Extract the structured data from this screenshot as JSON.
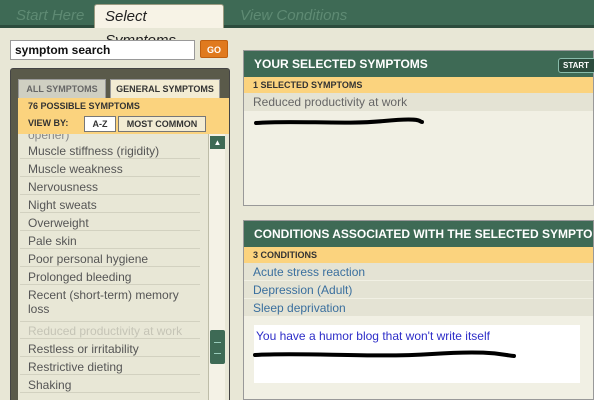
{
  "tabs": {
    "start": "Start Here",
    "select": "Select Symptoms",
    "view": "View Conditions"
  },
  "search": {
    "value": "symptom search",
    "go_label": "GO"
  },
  "left_panel": {
    "subtab_all": "ALL SYMPTOMS",
    "subtab_general": "GENERAL SYMPTOMS",
    "possible_count": "76 POSSIBLE SYMPTOMS",
    "view_by": "VIEW BY:",
    "sort_az": "A-Z",
    "sort_common": "MOST COMMON",
    "cut_item": "opener)",
    "symptoms": [
      "Muscle stiffness (rigidity)",
      "Muscle weakness",
      "Nervousness",
      "Night sweats",
      "Overweight",
      "Pale skin",
      "Poor personal hygiene",
      "Prolonged bleeding",
      "Recent (short-term) memory loss",
      "Reduced productivity at work",
      "Restless or irritability",
      "Restrictive dieting",
      "Shaking"
    ],
    "scroll_position": 0.72
  },
  "selected_panel": {
    "title": "YOUR SELECTED SYMPTOMS",
    "start_label": "START",
    "count": "1 SELECTED SYMPTOMS",
    "items": [
      "Reduced productivity at work"
    ]
  },
  "conditions_panel": {
    "title": "CONDITIONS ASSOCIATED WITH THE SELECTED SYMPTOMS",
    "count": "3 CONDITIONS",
    "items": [
      "Acute stress reaction",
      "Depression (Adult)",
      "Sleep deprivation"
    ],
    "extra": "You have a humor blog that won't write itself"
  },
  "colors": {
    "header_green": "#3e6a55",
    "accent_orange": "#e07a1e",
    "highlight_yellow": "#fbd37e",
    "link_blue": "#3a6f9e"
  }
}
